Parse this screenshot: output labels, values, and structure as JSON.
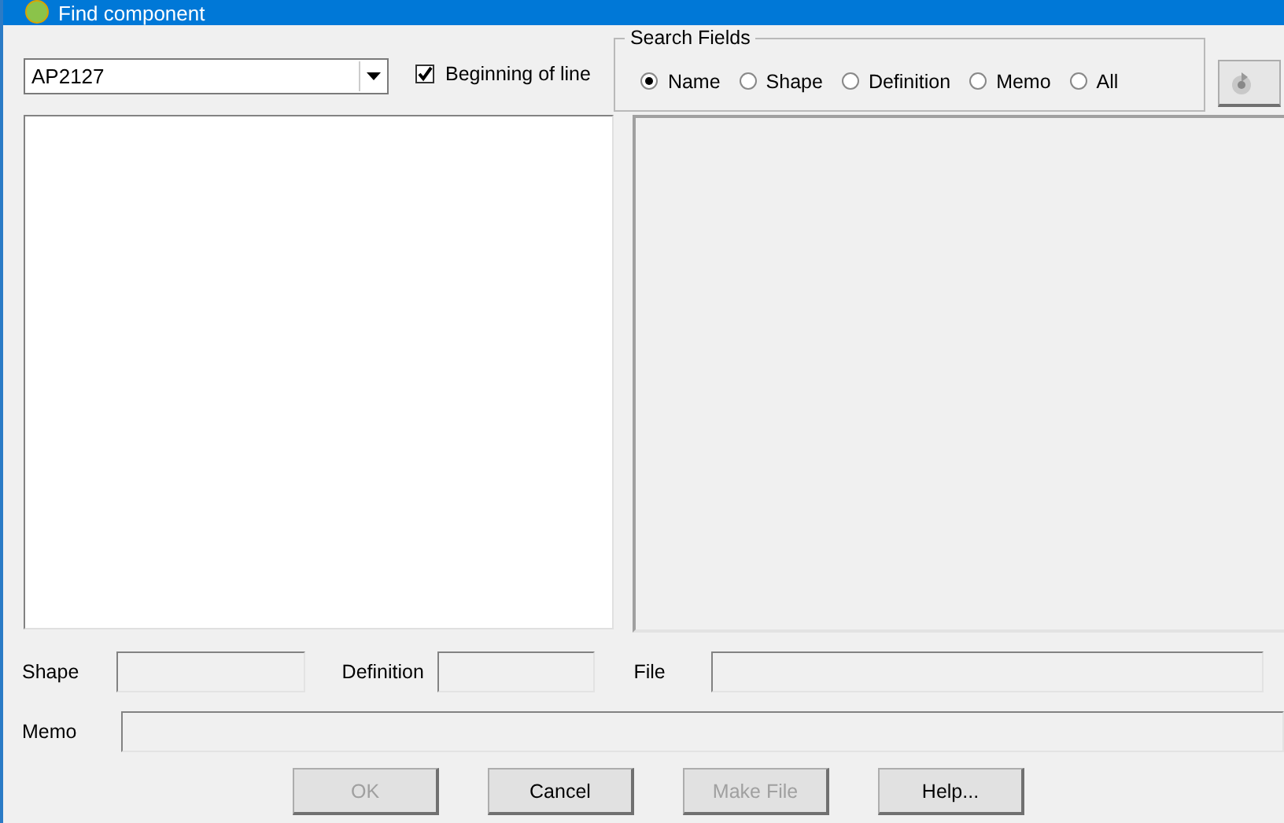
{
  "window": {
    "title": "Find component"
  },
  "search_combo": {
    "value": "AP2127"
  },
  "beginning_of_line": {
    "label": "Beginning of line",
    "checked": true
  },
  "search_fields": {
    "title": "Search Fields",
    "options": [
      {
        "label": "Name",
        "selected": true
      },
      {
        "label": "Shape",
        "selected": false
      },
      {
        "label": "Definition",
        "selected": false
      },
      {
        "label": "Memo",
        "selected": false
      },
      {
        "label": "All",
        "selected": false
      }
    ]
  },
  "details": [
    {
      "label": "Shape"
    },
    {
      "label": "Definition"
    },
    {
      "label": "File"
    }
  ],
  "memo": {
    "label": "Memo"
  },
  "buttons": [
    {
      "label": "OK",
      "disabled": true
    },
    {
      "label": "Cancel",
      "disabled": false
    },
    {
      "label": "Make File",
      "disabled": true
    },
    {
      "label": "Help...",
      "disabled": false
    }
  ]
}
